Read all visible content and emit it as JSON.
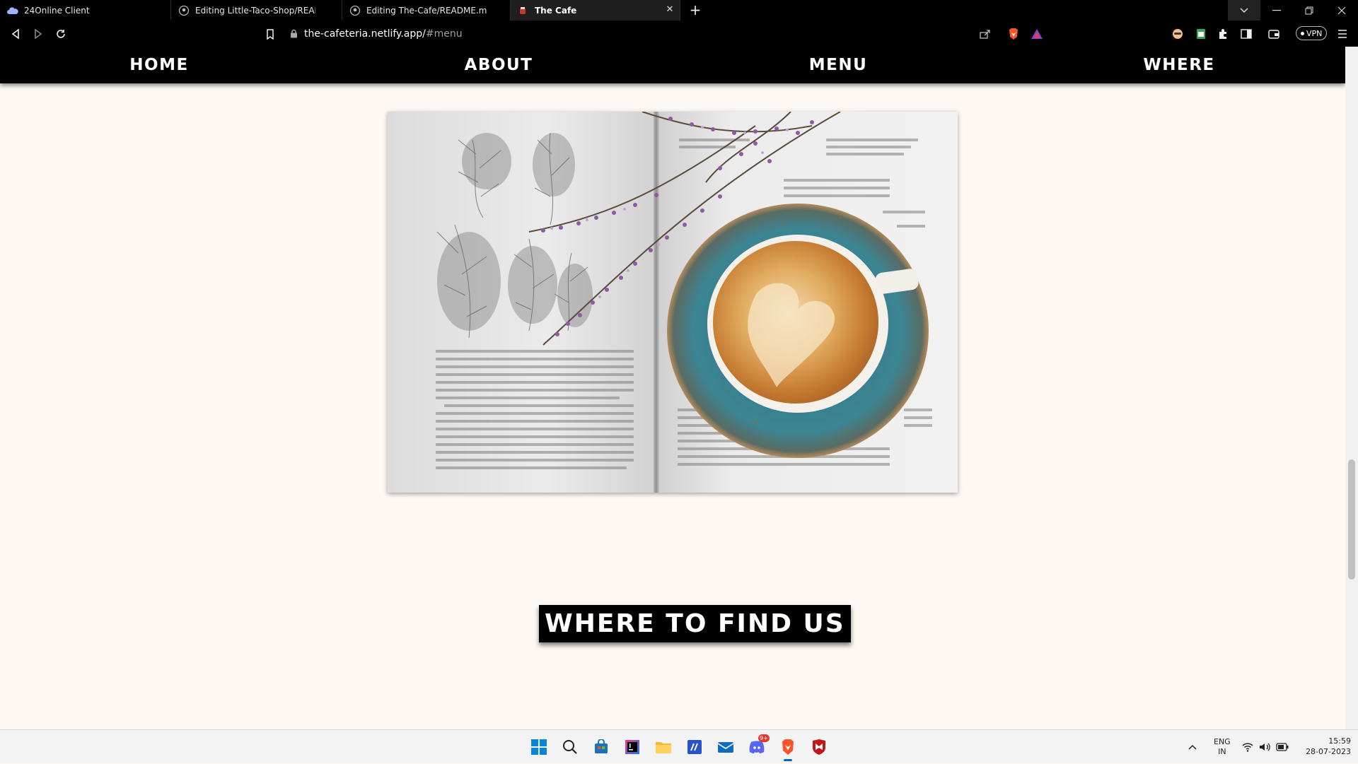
{
  "browser": {
    "tabs": [
      {
        "title": "24Online Client",
        "icon": "cloud-icon"
      },
      {
        "title": "Editing Little-Taco-Shop/README.md",
        "icon": "github-icon"
      },
      {
        "title": "Editing The-Cafe/README.md at main",
        "icon": "github-icon"
      },
      {
        "title": "The Cafe",
        "icon": "cafe-favicon",
        "active": true
      }
    ],
    "url_host": "the-cafeteria.netlify.app/",
    "url_path": "#menu",
    "vpn_label": "VPN"
  },
  "site": {
    "nav": [
      "HOME",
      "ABOUT",
      "MENU",
      "WHERE"
    ],
    "section_heading": "WHERE TO FIND US",
    "image_alt": "Coffee cup on an open book with heather flowers"
  },
  "taskbar": {
    "language_line1": "ENG",
    "language_line2": "IN",
    "time": "15:59",
    "date": "28-07-2023",
    "discord_badge": "9+"
  },
  "colors": {
    "page_background": "#fdf8f3",
    "nav_background": "#000000",
    "brave_orange": "#fb542b"
  }
}
